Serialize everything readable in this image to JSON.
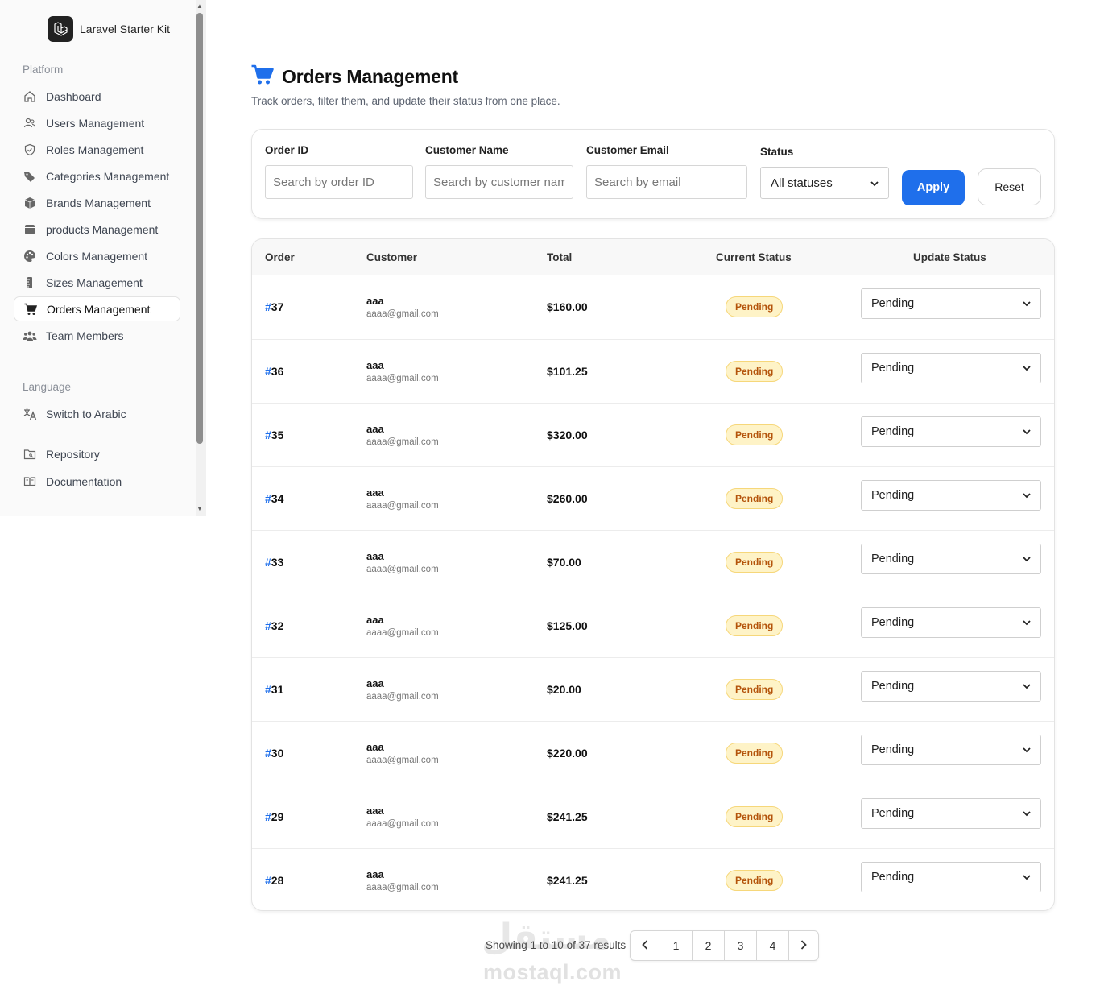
{
  "brand": {
    "name": "Laravel Starter Kit"
  },
  "sidebar": {
    "platform_label": "Platform",
    "items": [
      {
        "label": "Dashboard",
        "icon": "home-icon"
      },
      {
        "label": "Users Management",
        "icon": "users-icon"
      },
      {
        "label": "Roles Management",
        "icon": "shield-icon"
      },
      {
        "label": "Categories Management",
        "icon": "tags-icon"
      },
      {
        "label": "Brands Management",
        "icon": "cube-icon"
      },
      {
        "label": "products Management",
        "icon": "box-icon"
      },
      {
        "label": "Colors Management",
        "icon": "palette-icon"
      },
      {
        "label": "Sizes Management",
        "icon": "ruler-icon"
      },
      {
        "label": "Orders Management",
        "icon": "cart-icon"
      },
      {
        "label": "Team Members",
        "icon": "team-icon"
      }
    ],
    "language_label": "Language",
    "switch_language": "Switch to Arabic",
    "repository": "Repository",
    "documentation": "Documentation"
  },
  "page": {
    "title": "Orders Management",
    "subtitle": "Track orders, filter them, and update their status from one place."
  },
  "filters": {
    "order_id_label": "Order ID",
    "order_id_placeholder": "Search by order ID",
    "customer_name_label": "Customer Name",
    "customer_name_placeholder": "Search by customer name",
    "customer_email_label": "Customer Email",
    "customer_email_placeholder": "Search by email",
    "status_label": "Status",
    "status_value": "All statuses",
    "apply": "Apply",
    "reset": "Reset"
  },
  "table": {
    "headers": {
      "order": "Order",
      "customer": "Customer",
      "total": "Total",
      "current_status": "Current Status",
      "update_status": "Update Status"
    },
    "rows": [
      {
        "hash": "#",
        "id": "37",
        "name": "aaa",
        "email": "aaaa@gmail.com",
        "total": "$160.00",
        "status": "Pending",
        "update": "Pending"
      },
      {
        "hash": "#",
        "id": "36",
        "name": "aaa",
        "email": "aaaa@gmail.com",
        "total": "$101.25",
        "status": "Pending",
        "update": "Pending"
      },
      {
        "hash": "#",
        "id": "35",
        "name": "aaa",
        "email": "aaaa@gmail.com",
        "total": "$320.00",
        "status": "Pending",
        "update": "Pending"
      },
      {
        "hash": "#",
        "id": "34",
        "name": "aaa",
        "email": "aaaa@gmail.com",
        "total": "$260.00",
        "status": "Pending",
        "update": "Pending"
      },
      {
        "hash": "#",
        "id": "33",
        "name": "aaa",
        "email": "aaaa@gmail.com",
        "total": "$70.00",
        "status": "Pending",
        "update": "Pending"
      },
      {
        "hash": "#",
        "id": "32",
        "name": "aaa",
        "email": "aaaa@gmail.com",
        "total": "$125.00",
        "status": "Pending",
        "update": "Pending"
      },
      {
        "hash": "#",
        "id": "31",
        "name": "aaa",
        "email": "aaaa@gmail.com",
        "total": "$20.00",
        "status": "Pending",
        "update": "Pending"
      },
      {
        "hash": "#",
        "id": "30",
        "name": "aaa",
        "email": "aaaa@gmail.com",
        "total": "$220.00",
        "status": "Pending",
        "update": "Pending"
      },
      {
        "hash": "#",
        "id": "29",
        "name": "aaa",
        "email": "aaaa@gmail.com",
        "total": "$241.25",
        "status": "Pending",
        "update": "Pending"
      },
      {
        "hash": "#",
        "id": "28",
        "name": "aaa",
        "email": "aaaa@gmail.com",
        "total": "$241.25",
        "status": "Pending",
        "update": "Pending"
      }
    ]
  },
  "pagination": {
    "summary": "Showing 1 to 10 of 37 results",
    "pages": [
      "1",
      "2",
      "3",
      "4"
    ],
    "prev_icon": "chevron-left-icon",
    "next_icon": "chevron-right-icon"
  },
  "watermark": {
    "arabic": "مستقل",
    "latin": "mostaql.com"
  },
  "colors": {
    "accent": "#1f6feb",
    "pending_bg": "#fef3c7",
    "pending_text": "#b4540b"
  }
}
